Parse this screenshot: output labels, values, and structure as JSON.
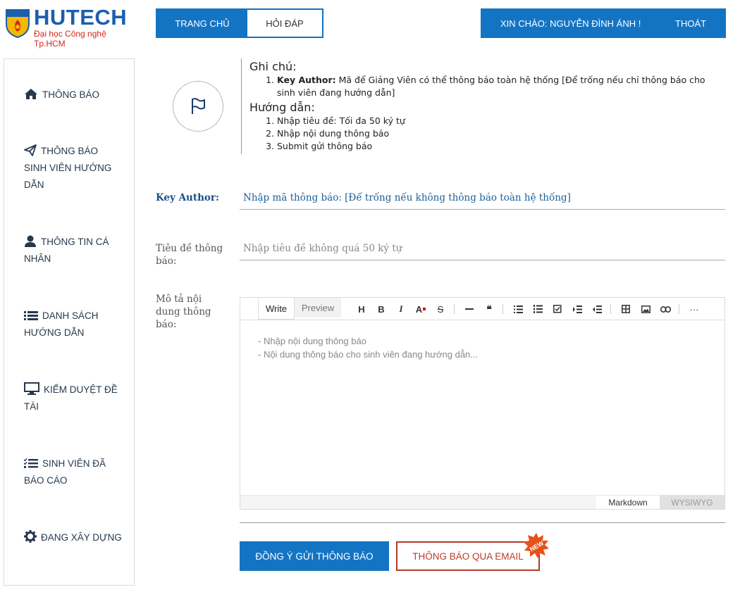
{
  "logo": {
    "title": "HUTECH",
    "subtitle": "Đại học Công nghệ Tp.HCM"
  },
  "topnav": {
    "home": "TRANG CHỦ",
    "qa": "HỎI ĐÁP"
  },
  "userbar": {
    "greeting": "XIN CHÀO: NGUYỄN ĐÌNH ÁNH !",
    "logout": "THOÁT"
  },
  "sidebar": {
    "items": [
      {
        "label": "THÔNG BÁO",
        "icon": "home-icon"
      },
      {
        "label": "THÔNG BÁO SINH VIÊN HƯỚNG DẪN",
        "icon": "paper-plane-icon"
      },
      {
        "label": "THÔNG TIN CÁ NHÂN",
        "icon": "user-icon"
      },
      {
        "label": "DANH SÁCH HƯỚNG DẪN",
        "icon": "list-icon"
      },
      {
        "label": "KIỂM DUYỆT ĐỀ TÀI",
        "icon": "monitor-icon"
      },
      {
        "label": "SINH VIÊN ĐÃ BÁO CÁO",
        "icon": "checklist-icon"
      },
      {
        "label": "ĐANG XÂY DỰNG",
        "icon": "gear-icon"
      }
    ]
  },
  "info": {
    "note_title": "Ghi chú:",
    "note_key_bold": "Key Author:",
    "note_key_text": " Mã để Giảng Viên có thể thông báo toàn hệ thống [Để trống nếu chỉ thông báo cho sinh viên đang hướng dẫn]",
    "guide_title": "Hướng dẫn:",
    "guide_steps": [
      "Nhập tiêu đề: Tối đa 50 ký tự",
      "Nhập nội dung thông báo",
      "Submit gửi thông báo"
    ]
  },
  "form": {
    "key_label": "Key Author:",
    "key_placeholder": "Nhập mã thông báo: [Để trống nếu không thông báo toàn hệ thống]",
    "title_label": "Tiêu đề thông báo:",
    "title_placeholder": "Nhập tiêu đề không quá 50 ký tự",
    "desc_label": "Mô tả nội dung thông báo:"
  },
  "editor": {
    "tab_write": "Write",
    "tab_preview": "Preview",
    "content_line1": "- Nhập nội dung thông báo",
    "content_line2": "- Nội dung thông báo cho sinh viên đang hướng dẫn...",
    "mode_markdown": "Markdown",
    "mode_wysiwyg": "WYSIWYG",
    "tool_heading": "H",
    "tool_bold": "B",
    "tool_italic": "I",
    "tool_color": "A",
    "tool_strike": "S",
    "tool_quote": "❝",
    "tool_more": "···"
  },
  "actions": {
    "submit": "ĐỒNG Ý GỬI THÔNG BÁO",
    "email": "THÔNG BÁO QUA EMAIL",
    "new_badge": "NEW"
  },
  "colors": {
    "primary": "#1474c4",
    "email_border": "#b33a2a",
    "badge": "#e8501a"
  }
}
